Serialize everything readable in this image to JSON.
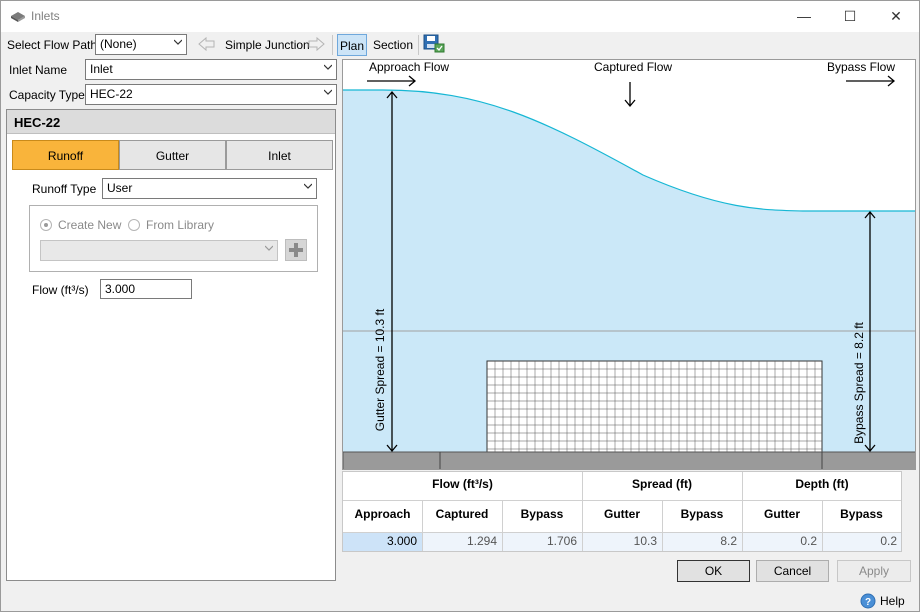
{
  "window": {
    "title": "Inlets",
    "minimize": "—",
    "maximize": "☐",
    "close": "✕"
  },
  "toolbar": {
    "flow_path_label": "Select Flow Path",
    "flow_path_value": "(None)",
    "junction_label": "Simple Junction",
    "plan_label": "Plan",
    "section_label": "Section"
  },
  "form": {
    "inlet_name_label": "Inlet Name",
    "inlet_name_value": "Inlet",
    "capacity_type_label": "Capacity Type",
    "capacity_type_value": "HEC-22"
  },
  "panel": {
    "title": "HEC-22",
    "tabs": [
      {
        "label": "Runoff",
        "active": true
      },
      {
        "label": "Gutter",
        "active": false
      },
      {
        "label": "Inlet",
        "active": false
      }
    ],
    "runoff_type_label": "Runoff Type",
    "runoff_type_value": "User",
    "create_new_label": "Create New",
    "from_library_label": "From Library",
    "library_value": "",
    "flow_label": "Flow (ft³/s)",
    "flow_value": "3.000"
  },
  "graphic": {
    "approach_flow": "Approach Flow",
    "captured_flow": "Captured Flow",
    "bypass_flow": "Bypass Flow",
    "gutter_spread": "Gutter Spread = 10.3 ft",
    "bypass_spread": "Bypass Spread = 8.2 ft",
    "water_color": "#cbe8f8",
    "line_color": "#16b7d4"
  },
  "table": {
    "groups": [
      "Flow (ft³/s)",
      "Spread (ft)",
      "Depth (ft)"
    ],
    "columns": [
      "Approach",
      "Captured",
      "Bypass",
      "Gutter",
      "Bypass",
      "Gutter",
      "Bypass"
    ],
    "values": [
      "3.000",
      "1.294",
      "1.706",
      "10.3",
      "8.2",
      "0.2",
      "0.2"
    ]
  },
  "buttons": {
    "ok": "OK",
    "cancel": "Cancel",
    "apply": "Apply",
    "help": "Help"
  }
}
